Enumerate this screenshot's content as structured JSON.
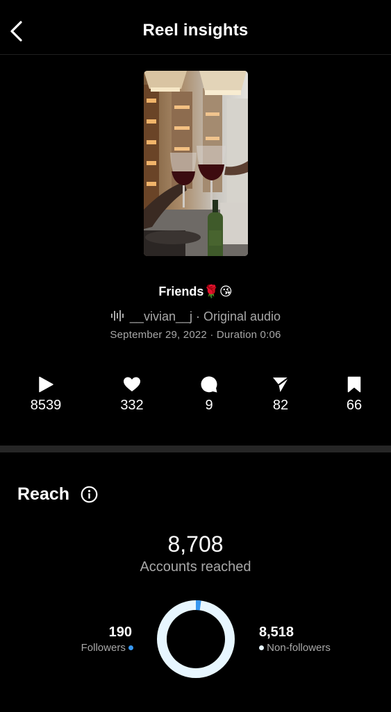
{
  "header": {
    "title": "Reel insights"
  },
  "reel": {
    "caption": "Friends🌹😘",
    "author": "__vivian__j",
    "audio": "Original audio",
    "date": "September 29, 2022",
    "duration": "Duration 0:06"
  },
  "stats": {
    "plays": "8539",
    "likes": "332",
    "comments": "9",
    "shares": "82",
    "saves": "66"
  },
  "reach": {
    "title": "Reach",
    "accounts_reached": "8,708",
    "accounts_reached_label": "Accounts reached",
    "followers": "190",
    "followers_label": "Followers",
    "non_followers": "8,518",
    "non_followers_label": "Non-followers",
    "followers_color": "#3797f0",
    "non_followers_color": "#e7f6ff"
  },
  "colors": {
    "background": "#000000",
    "secondary_text": "#a8a8a8",
    "divider": "#262626"
  }
}
